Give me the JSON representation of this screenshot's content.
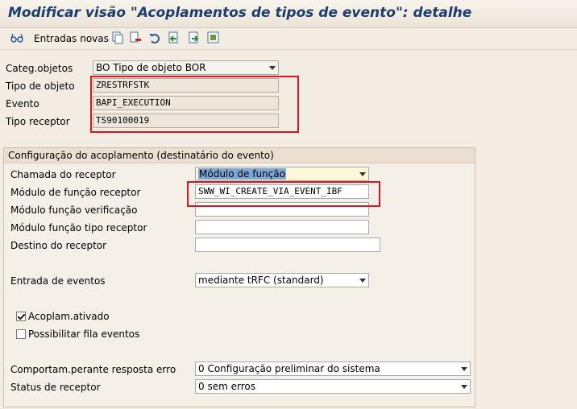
{
  "window": {
    "title": "Modificar visão \"Acoplamentos de tipos de evento\": detalhe"
  },
  "toolbar": {
    "new_entries_label": "Entradas novas",
    "icons": [
      "glasses-icon",
      "copy-icon",
      "delete-icon",
      "undo-icon",
      "previous-entry-icon",
      "next-entry-icon",
      "select-all-icon"
    ]
  },
  "header_fields": {
    "object_category": {
      "label": "Categ.objetos",
      "value": "BO Tipo de objeto BOR"
    },
    "object_type": {
      "label": "Tipo de objeto",
      "value": "ZRESTRFSTK"
    },
    "event": {
      "label": "Evento",
      "value": "BAPI_EXECUTION"
    },
    "receiver_type": {
      "label": "Tipo receptor",
      "value": "TS90100019"
    }
  },
  "coupling_config": {
    "group_title": "Configuração do acoplamento (destinatário do evento)",
    "receiver_call": {
      "label": "Chamada do receptor",
      "value": "Módulo de função"
    },
    "receiver_fm": {
      "label": "Módulo de função receptor",
      "value": "SWW_WI_CREATE_VIA_EVENT_IBF"
    },
    "check_fm": {
      "label": "Módulo função verificação",
      "value": ""
    },
    "receiver_type_fm": {
      "label": "Módulo função tipo receptor",
      "value": ""
    },
    "receiver_destination": {
      "label": "Destino do receptor",
      "value": ""
    },
    "event_delivery": {
      "label": "Entrada de eventos",
      "value": "mediante tRFC (standard)"
    },
    "coupling_active": {
      "label": "Acoplam.ativado",
      "checked": true
    },
    "enable_event_queue": {
      "label": "Possibilitar fila eventos",
      "checked": false
    },
    "error_behavior": {
      "label": "Comportam.perante resposta erro",
      "value": "0 Configuração preliminar do sistema"
    },
    "receiver_status": {
      "label": "Status de receptor",
      "value": "0 sem erros"
    }
  },
  "colors": {
    "title": "#1a3d6e",
    "highlight_box": "#e0141e",
    "background": "#f2ece3"
  }
}
